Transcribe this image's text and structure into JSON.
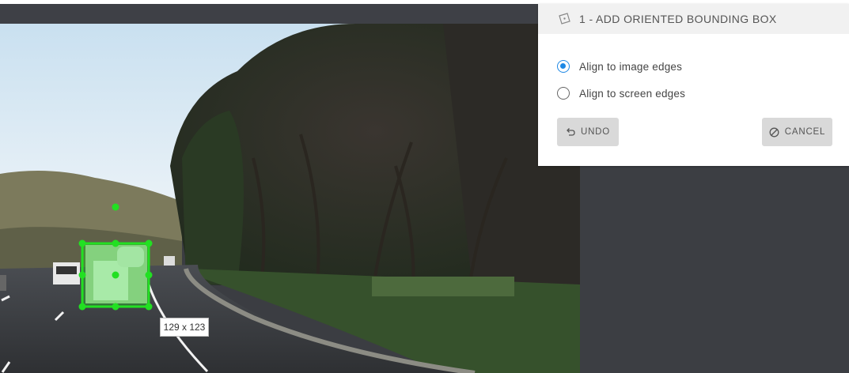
{
  "panel": {
    "title": "1 - ADD ORIENTED BOUNDING BOX",
    "icon": "oriented-box-icon",
    "options": [
      {
        "label": "Align to image edges",
        "checked": true
      },
      {
        "label": "Align to screen edges",
        "checked": false
      }
    ],
    "undo_label": "UNDO",
    "undo_icon": "undo-icon",
    "cancel_label": "CANCEL",
    "cancel_icon": "cancel-icon",
    "accent": "#1e88e5"
  },
  "annotation": {
    "dimensions": "129 x 123",
    "box_color": "#22e022"
  }
}
